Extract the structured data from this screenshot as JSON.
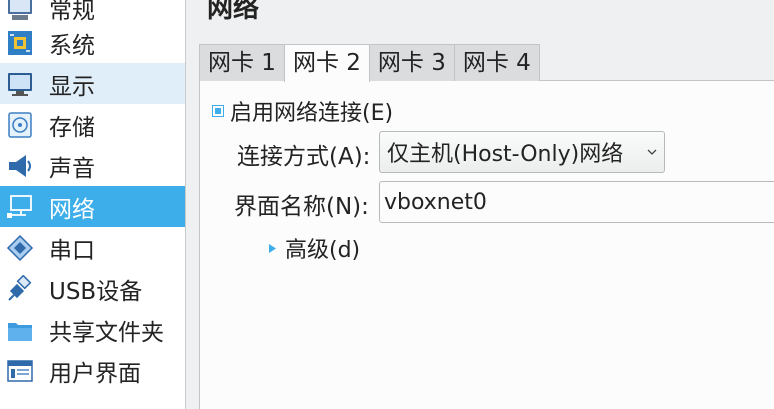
{
  "sidebar": {
    "items": [
      {
        "label": "常规",
        "icon": "general-icon"
      },
      {
        "label": "系统",
        "icon": "system-chip-icon"
      },
      {
        "label": "显示",
        "icon": "display-monitor-icon"
      },
      {
        "label": "存储",
        "icon": "storage-disc-icon"
      },
      {
        "label": "声音",
        "icon": "speaker-icon"
      },
      {
        "label": "网络",
        "icon": "network-icon",
        "selected": true
      },
      {
        "label": "串口",
        "icon": "serial-port-icon"
      },
      {
        "label": "USB设备",
        "icon": "usb-plug-icon"
      },
      {
        "label": "共享文件夹",
        "icon": "shared-folder-icon"
      },
      {
        "label": "用户界面",
        "icon": "user-interface-icon"
      }
    ]
  },
  "main": {
    "title": "网络",
    "tabs": [
      {
        "label": "网卡 1"
      },
      {
        "label": "网卡 2",
        "active": true
      },
      {
        "label": "网卡 3"
      },
      {
        "label": "网卡 4"
      }
    ],
    "enable_checkbox": {
      "label": "启用网络连接(E)",
      "checked": true
    },
    "attached_to": {
      "label": "连接方式(A):",
      "value": "仅主机(Host-Only)网络"
    },
    "interface_name": {
      "label": "界面名称(N):",
      "value": "vboxnet0"
    },
    "advanced": {
      "label": "高级(d)"
    }
  },
  "colors": {
    "accent": "#3daee9",
    "hover": "#e0eefa",
    "window_bg": "#eff0f1"
  }
}
